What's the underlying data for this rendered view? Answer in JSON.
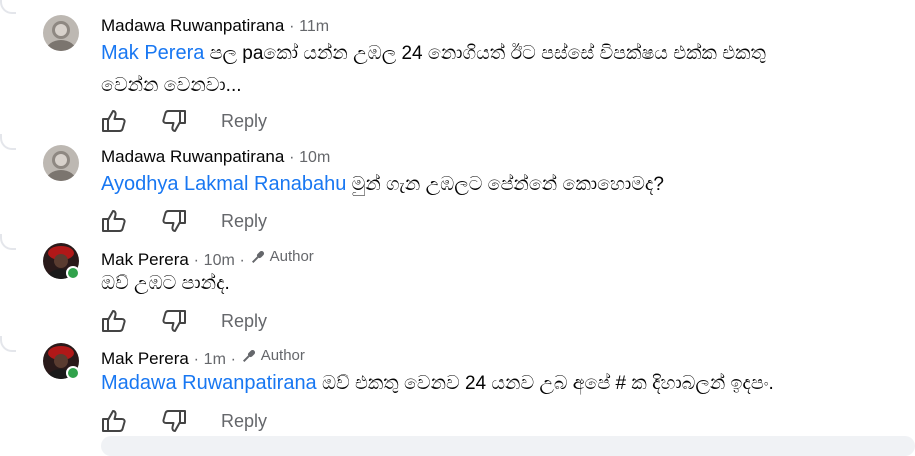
{
  "comments": [
    {
      "author": "Madawa Ruwanpatirana",
      "time": "11m",
      "badge": "",
      "mention": "Mak Perera",
      "text_line1": " පල paකෝ යන්න උඹල 24 නොගියත් ඊට පස්සේ විපක්ෂය එක්ක එකතු",
      "text_line2": "වෙන්න වෙනවා...",
      "reply_label": "Reply"
    },
    {
      "author": "Madawa Ruwanpatirana",
      "time": "10m",
      "badge": "",
      "mention": "Ayodhya Lakmal Ranabahu",
      "text_line1": " මුන් ගැන උඹලට පේන්නේ කොහොමද?",
      "text_line2": "",
      "reply_label": "Reply"
    },
    {
      "author": "Mak Perera",
      "time": "10m",
      "badge": "Author",
      "mention": "",
      "text_line1": "ඔව් උඹට පාන්ද.",
      "text_line2": "",
      "reply_label": "Reply"
    },
    {
      "author": "Mak Perera",
      "time": "1m",
      "badge": "Author",
      "mention": "Madawa Ruwanpatirana",
      "text_line1": " ඔව් එකතු වෙනව 24 යනව උබ අපේ # ක දිහාබලන් ඉදපං.",
      "text_line2": "",
      "reply_label": "Reply"
    }
  ],
  "separator": "·",
  "colors": {
    "mention": "#1877f2",
    "muted": "#65676b",
    "online": "#31a24c"
  },
  "icons": {
    "like": "thumbs-up-icon",
    "dislike": "thumbs-down-icon",
    "author": "microphone-icon"
  }
}
